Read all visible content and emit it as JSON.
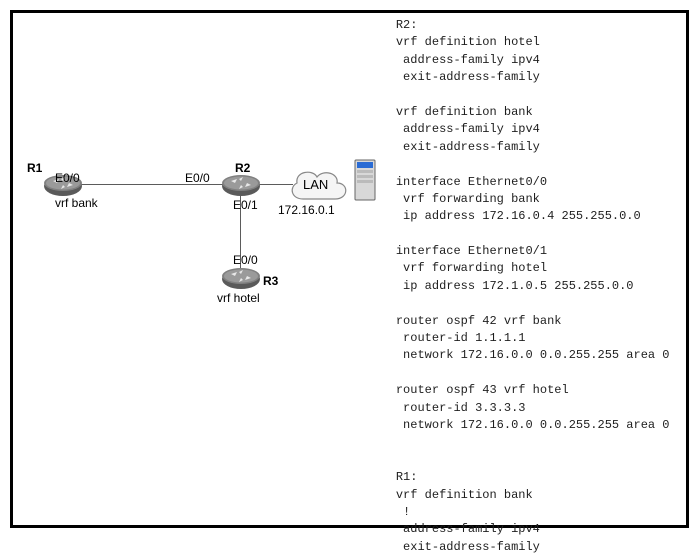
{
  "diagram": {
    "r1": {
      "name": "R1",
      "iface": "E0/0",
      "vrf": "vrf bank"
    },
    "r2": {
      "name": "R2",
      "ifaceLeft": "E0/0",
      "ifaceDown": "E0/1",
      "lanLabel": "LAN"
    },
    "r3": {
      "name": "R3",
      "iface": "E0/0",
      "vrf": "vrf hotel"
    },
    "serverIp": "172.16.0.1"
  },
  "config": {
    "r2_header": "R2:",
    "r2_vrf_hotel": "vrf definition hotel\n address-family ipv4\n exit-address-family",
    "r2_vrf_bank": "vrf definition bank\n address-family ipv4\n exit-address-family",
    "r2_int_e00": "interface Ethernet0/0\n vrf forwarding bank\n ip address 172.16.0.4 255.255.0.0",
    "r2_int_e01": "interface Ethernet0/1\n vrf forwarding hotel\n ip address 172.1.0.5 255.255.0.0",
    "r2_ospf42": "router ospf 42 vrf bank\n router-id 1.1.1.1\n network 172.16.0.0 0.0.255.255 area 0",
    "r2_ospf43": "router ospf 43 vrf hotel\n router-id 3.3.3.3\n network 172.16.0.0 0.0.255.255 area 0",
    "r1_header": "R1:",
    "r1_vrf_bank": "vrf definition bank\n !\n address-family ipv4\n exit-address-family"
  }
}
